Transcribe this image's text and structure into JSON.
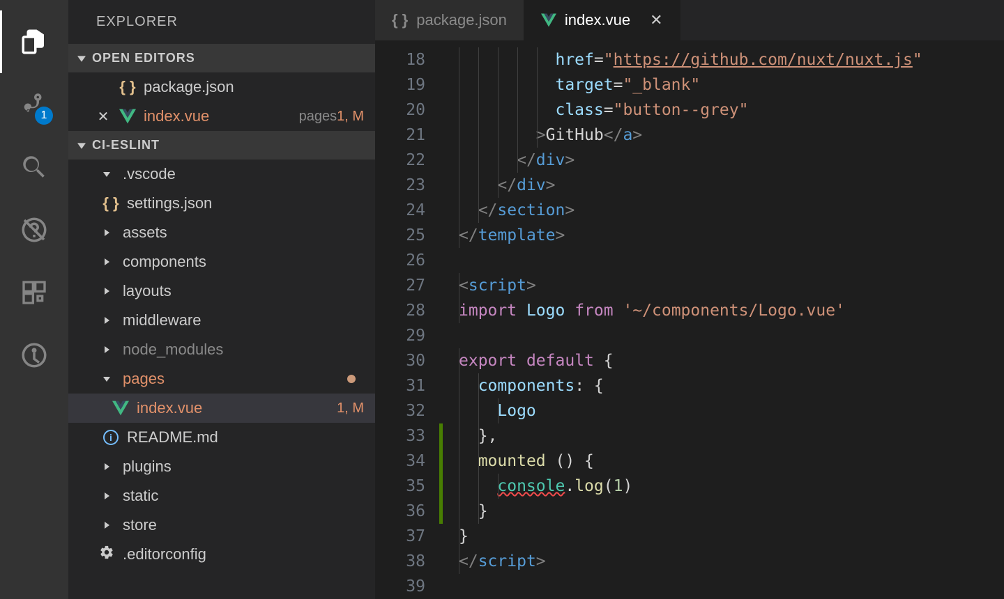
{
  "sidebar_title": "EXPLORER",
  "activity": {
    "badge_scm": "1"
  },
  "sections": {
    "open_editors": "OPEN EDITORS",
    "project": "CI-ESLINT"
  },
  "open_editors": [
    {
      "icon": "braces",
      "label": "package.json"
    },
    {
      "icon": "vue",
      "label": "index.vue",
      "desc": "pages",
      "status": "1, M",
      "modified": true,
      "close": true
    }
  ],
  "tree": [
    {
      "kind": "folder-open",
      "label": ".vscode",
      "indent": "indent1"
    },
    {
      "kind": "file",
      "icon": "braces",
      "label": "settings.json",
      "indent": "indent1b"
    },
    {
      "kind": "folder",
      "label": "assets",
      "indent": "indent1"
    },
    {
      "kind": "folder",
      "label": "components",
      "indent": "indent1"
    },
    {
      "kind": "folder",
      "label": "layouts",
      "indent": "indent1"
    },
    {
      "kind": "folder",
      "label": "middleware",
      "indent": "indent1"
    },
    {
      "kind": "folder",
      "label": "node_modules",
      "indent": "indent1",
      "dim": true
    },
    {
      "kind": "folder-open",
      "label": "pages",
      "indent": "indent1",
      "orange": true,
      "dot": true
    },
    {
      "kind": "file",
      "icon": "vue",
      "label": "index.vue",
      "indent": "indent2",
      "orange": true,
      "status": "1, M",
      "active": true
    },
    {
      "kind": "file",
      "icon": "info",
      "label": "README.md",
      "indent": "indent1b"
    },
    {
      "kind": "folder",
      "label": "plugins",
      "indent": "indent1"
    },
    {
      "kind": "folder",
      "label": "static",
      "indent": "indent1"
    },
    {
      "kind": "folder",
      "label": "store",
      "indent": "indent1"
    },
    {
      "kind": "file",
      "icon": "gear",
      "label": ".editorconfig",
      "indent": "indent1"
    }
  ],
  "tabs": [
    {
      "icon": "braces",
      "label": "package.json",
      "active": false
    },
    {
      "icon": "vue",
      "label": "index.vue",
      "active": true,
      "close": true
    }
  ],
  "code": {
    "first_line_no": 18,
    "lines": [
      {
        "n": 18,
        "guides": [
          0,
          1,
          2,
          3,
          4
        ],
        "html": "          <span class='c-attr'>href</span><span class='c-text'>=</span><span class='c-str'>\"</span><span class='c-str c-und'>https://github.com/nuxt/nuxt.js</span><span class='c-str'>\"</span>"
      },
      {
        "n": 19,
        "guides": [
          0,
          1,
          2,
          3,
          4
        ],
        "html": "          <span class='c-attr'>target</span><span class='c-text'>=</span><span class='c-str'>\"_blank\"</span>"
      },
      {
        "n": 20,
        "guides": [
          0,
          1,
          2,
          3,
          4
        ],
        "html": "          <span class='c-attr'>class</span><span class='c-text'>=</span><span class='c-str'>\"button--grey\"</span>"
      },
      {
        "n": 21,
        "guides": [
          0,
          1,
          2,
          3,
          4
        ],
        "html": "        <span class='c-punc'>&gt;</span><span class='c-text'>GitHub</span><span class='c-punc'>&lt;/</span><span class='c-tag'>a</span><span class='c-punc'>&gt;</span>"
      },
      {
        "n": 22,
        "guides": [
          0,
          1,
          2,
          3
        ],
        "html": "      <span class='c-punc'>&lt;/</span><span class='c-tag'>div</span><span class='c-punc'>&gt;</span>"
      },
      {
        "n": 23,
        "guides": [
          0,
          1,
          2
        ],
        "html": "    <span class='c-punc'>&lt;/</span><span class='c-tag'>div</span><span class='c-punc'>&gt;</span>"
      },
      {
        "n": 24,
        "guides": [
          0,
          1
        ],
        "html": "  <span class='c-punc'>&lt;/</span><span class='c-tag'>section</span><span class='c-punc'>&gt;</span>"
      },
      {
        "n": 25,
        "guides": [
          0
        ],
        "html": "<span class='c-punc'>&lt;/</span><span class='c-tag'>template</span><span class='c-punc'>&gt;</span>"
      },
      {
        "n": 26,
        "guides": [],
        "html": ""
      },
      {
        "n": 27,
        "guides": [
          0
        ],
        "html": "<span class='c-punc'>&lt;</span><span class='c-tag'>script</span><span class='c-punc'>&gt;</span>"
      },
      {
        "n": 28,
        "guides": [
          0
        ],
        "html": "<span class='c-kw'>import</span> <span class='c-var'>Logo</span> <span class='c-kw'>from</span> <span class='c-str'>'~/components/Logo.vue'</span>"
      },
      {
        "n": 29,
        "guides": [],
        "html": ""
      },
      {
        "n": 30,
        "guides": [
          0
        ],
        "html": "<span class='c-kw'>export</span> <span class='c-kw'>default</span> <span class='c-text'>{</span>"
      },
      {
        "n": 31,
        "guides": [
          0,
          1
        ],
        "html": "  <span class='c-obj'>components</span><span class='c-text'>:</span> <span class='c-text'>{</span>"
      },
      {
        "n": 32,
        "guides": [
          0,
          1,
          2
        ],
        "html": "    <span class='c-var'>Logo</span>"
      },
      {
        "n": 33,
        "guides": [
          0,
          1
        ],
        "html": "  <span class='c-text'>},</span>",
        "mod": true
      },
      {
        "n": 34,
        "guides": [
          0,
          1
        ],
        "html": "  <span class='c-func'>mounted</span> <span class='c-text'>() {</span>",
        "mod": true
      },
      {
        "n": 35,
        "guides": [
          0,
          1,
          2
        ],
        "html": "    <span class='c-type c-squig'>console</span><span class='c-text'>.</span><span class='c-func'>log</span><span class='c-text'>(</span><span class='c-num'>1</span><span class='c-text'>)</span>",
        "mod": true
      },
      {
        "n": 36,
        "guides": [
          0,
          1
        ],
        "html": "  <span class='c-text'>}</span>",
        "mod": true
      },
      {
        "n": 37,
        "guides": [
          0
        ],
        "html": "<span class='c-text'>}</span>"
      },
      {
        "n": 38,
        "guides": [
          0
        ],
        "html": "<span class='c-punc'>&lt;/</span><span class='c-tag'>script</span><span class='c-punc'>&gt;</span>"
      },
      {
        "n": 39,
        "guides": [],
        "html": ""
      }
    ]
  }
}
